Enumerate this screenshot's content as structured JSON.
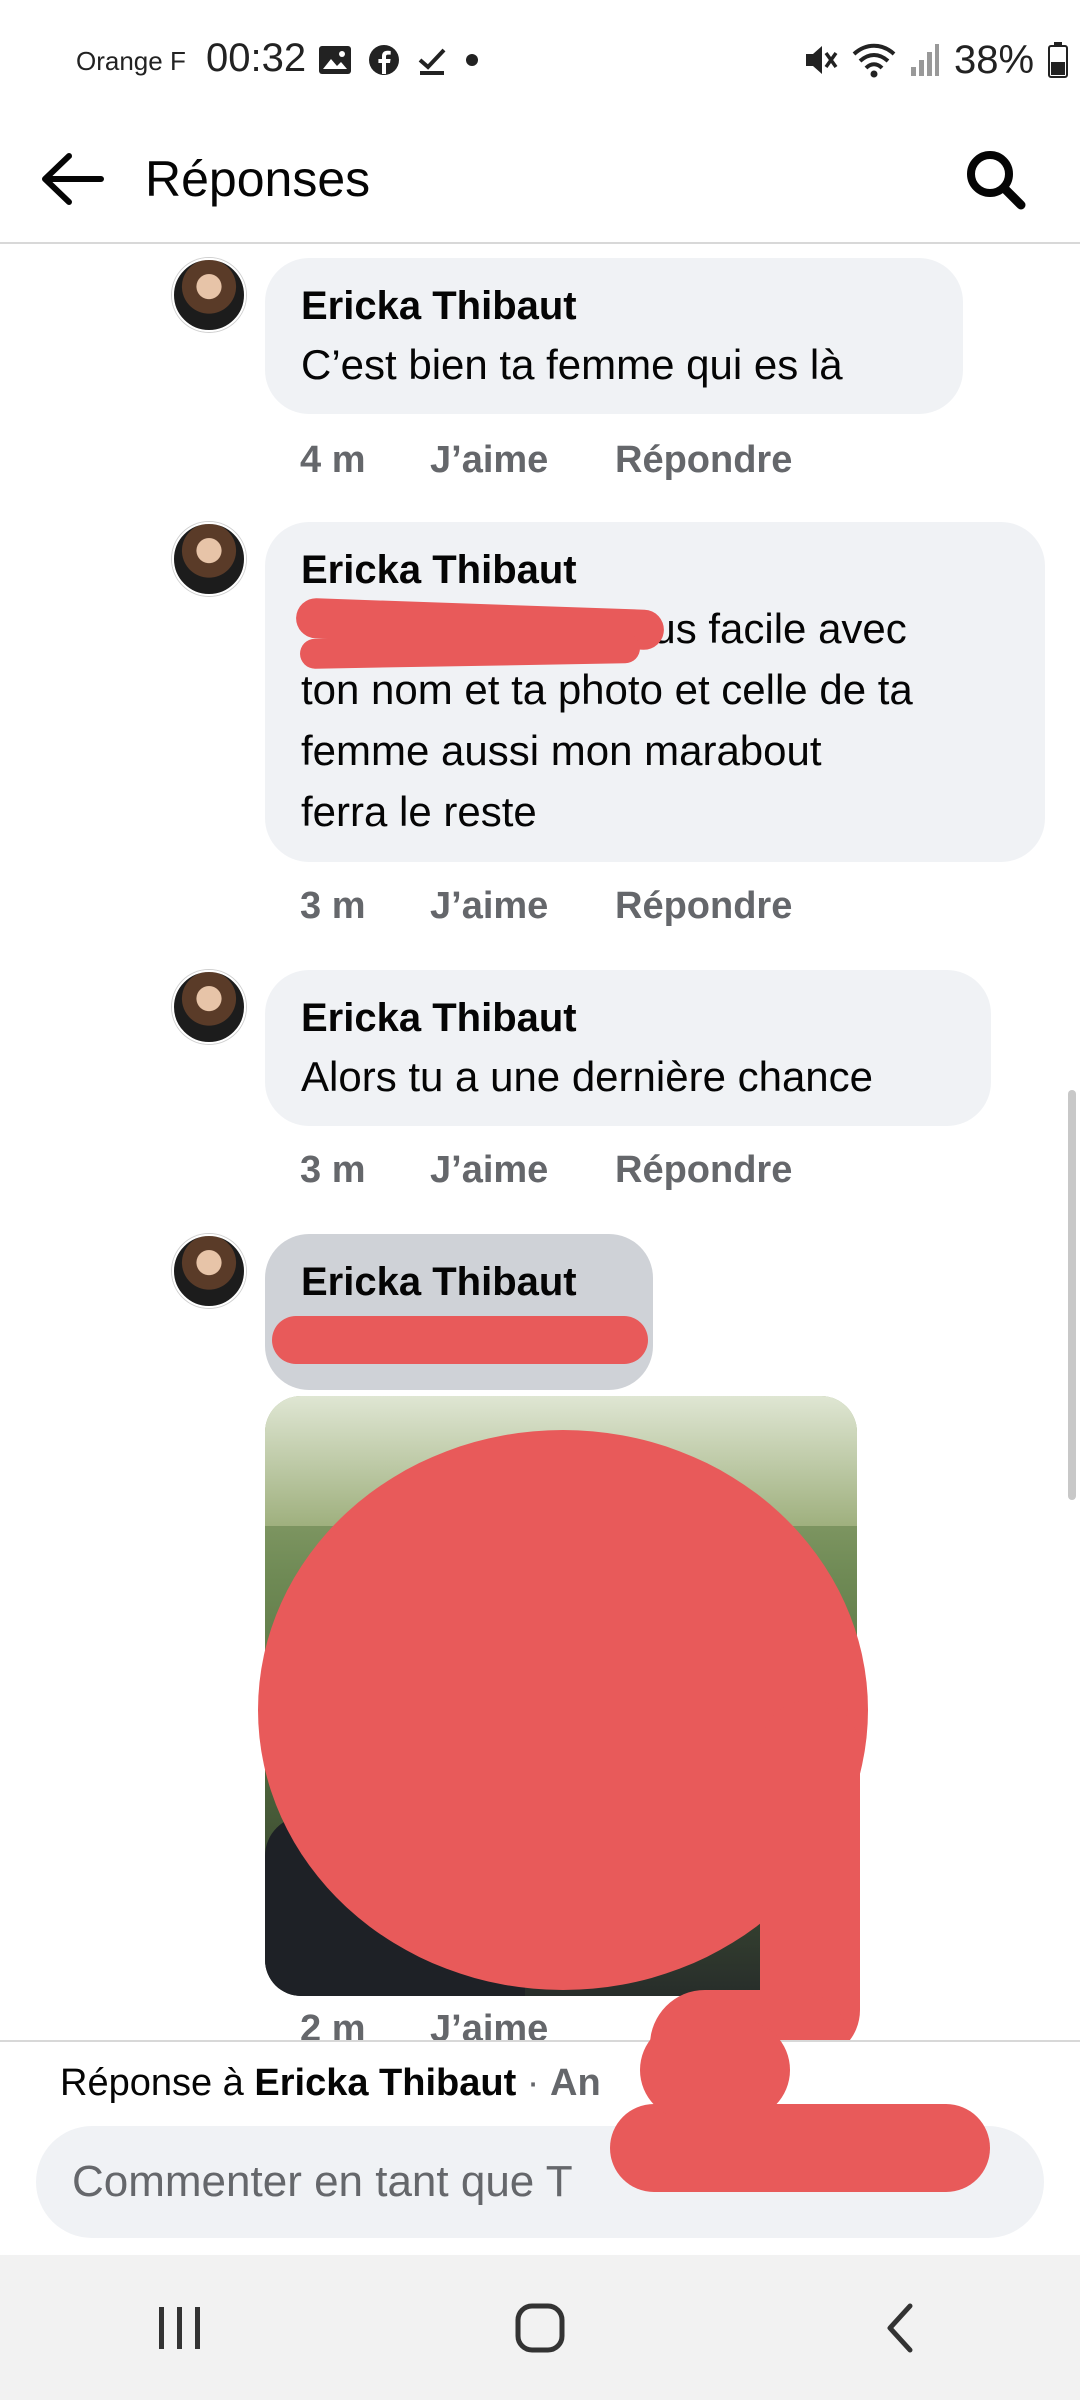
{
  "status_bar": {
    "carrier": "Orange F",
    "time": "00:32",
    "battery": "38%",
    "left_icons": [
      "gallery-icon",
      "facebook-icon",
      "download-done-icon",
      "dot-icon"
    ],
    "right_icons": [
      "mute-icon",
      "wifi-icon",
      "signal-icon",
      "battery-icon"
    ]
  },
  "header": {
    "title": "Réponses",
    "back_icon": "arrow-left-icon",
    "search_icon": "search-icon"
  },
  "comments": [
    {
      "author": "Ericka Thibaut",
      "text": "C’est bien ta femme qui es là",
      "time": "4 m",
      "like": "J’aime",
      "reply": "Répondre"
    },
    {
      "author": "Ericka Thibaut",
      "text_line1": "lus facile avec",
      "text_line2": "ton nom et ta photo et celle de ta",
      "text_line3": "femme aussi mon marabout",
      "text_line4": "ferra le reste",
      "time": "3 m",
      "like": "J’aime",
      "reply": "Répondre"
    },
    {
      "author": "Ericka Thibaut",
      "text": "Alors tu a une dernière chance",
      "time": "3 m",
      "like": "J’aime",
      "reply": "Répondre"
    },
    {
      "author": "Ericka Thibaut",
      "time": "2 m",
      "like": "J’aime"
    }
  ],
  "reply_bar": {
    "prefix": "Réponse à ",
    "author": "Ericka Thibaut",
    "separator": " · ",
    "cancel": "An",
    "input_placeholder": "Commenter en tant que T"
  },
  "colors": {
    "bubble": "#f0f2f5",
    "bubble_pressed": "#cfd2d7",
    "meta_text": "#65676b",
    "redaction": "#e85a5a"
  }
}
